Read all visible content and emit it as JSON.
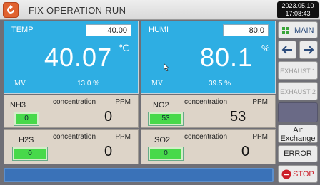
{
  "header": {
    "title": "FIX OPERATION RUN",
    "date": "2023.05.10",
    "time": "17:08:43"
  },
  "temp": {
    "label": "TEMP",
    "setpoint": "40.00",
    "value": "40.07",
    "unit": "℃",
    "mv_label": "MV",
    "mv_value": "13.0 %"
  },
  "humi": {
    "label": "HUMI",
    "setpoint": "80.0",
    "value": "80.1",
    "unit": "%",
    "mv_label": "MV",
    "mv_value": "39.5 %"
  },
  "gases": [
    {
      "name": "NH3",
      "conc_label": "concentration",
      "ppm_label": "PPM",
      "set": "0",
      "value": "0"
    },
    {
      "name": "NO2",
      "conc_label": "concentration",
      "ppm_label": "PPM",
      "set": "53",
      "value": "53"
    },
    {
      "name": "H2S",
      "conc_label": "concentration",
      "ppm_label": "PPM",
      "set": "0",
      "value": "0"
    },
    {
      "name": "SO2",
      "conc_label": "concentration",
      "ppm_label": "PPM",
      "set": "0",
      "value": "0"
    }
  ],
  "sidebar": {
    "main_label": "MAIN",
    "prev_icon": "arrow-left-icon",
    "next_icon": "arrow-right-icon",
    "exhaust1_label": "EXHAUST 1",
    "exhaust2_label": "EXHAUST 2",
    "air_exchange_label_1": "Air",
    "air_exchange_label_2": "Exchange",
    "error_label": "ERROR",
    "stop_label": "STOP"
  },
  "colors": {
    "panel_blue": "#2eaee3",
    "gas_bg": "#ddd4c8",
    "indicator_green": "#47d94a",
    "stop_red": "#cc1f2a"
  }
}
